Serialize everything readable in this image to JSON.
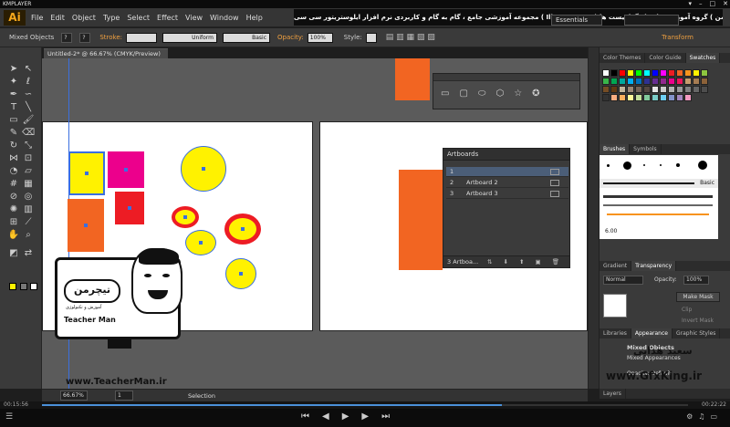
{
  "player": {
    "name": "KMPLAYER",
    "time_elapsed": "00:15:56",
    "time_total": "00:22:22"
  },
  "menu": {
    "items": [
      "File",
      "Edit",
      "Object",
      "Type",
      "Select",
      "Effect",
      "View",
      "Window",
      "Help"
    ],
    "course_title": "مجموعه آموزشی جامع ، گام به گام و کاربردی نرم افزار ایلوستریتور سی سی ( Illustrator cc )  مدرس : سعید هدایی ( تیچرمن ) گروه آموزشی پادشاه گرافیست ها",
    "workspace": "Essentials"
  },
  "control": {
    "selection_type": "Mixed Objects",
    "stroke_label": "Stroke:",
    "profile": "Uniform",
    "brush": "Basic",
    "opacity_label": "Opacity:",
    "opacity_value": "100%",
    "style_label": "Style:",
    "transform_label": "Transform"
  },
  "document": {
    "tab_title": "Untitled-2* @ 66.67% (CMYK/Preview)",
    "zoom": "66.67%",
    "page": "1",
    "status": "Selection"
  },
  "artboards_panel": {
    "title": "Artboards",
    "rows": [
      {
        "num": "1",
        "name": ""
      },
      {
        "num": "2",
        "name": "Artboard 2"
      },
      {
        "num": "3",
        "name": "Artboard 3"
      }
    ],
    "footer": "3 Artboa..."
  },
  "right_panels": {
    "tabs_top": [
      "Color Themes",
      "Color Guide",
      "Swatches"
    ],
    "tabs_brushes": [
      "Brushes",
      "Symbols"
    ],
    "brush_basic": "Basic",
    "brush_size": "6.00",
    "tabs_transparency": [
      "Gradient",
      "Transparency"
    ],
    "blend_mode": "Normal",
    "opacity_label": "Opacity:",
    "opacity_value": "100%",
    "make_mask": "Make Mask",
    "clip": "Clip",
    "invert_mask": "Invert Mask",
    "tabs_appearance": [
      "Libraries",
      "Appearance",
      "Graphic Styles"
    ],
    "appearance_title": "Mixed Objects",
    "appearance_sub": "Mixed Appearances",
    "appearance_opacity": "Opacity: Default",
    "layers_tab": "Layers"
  },
  "watermark": {
    "logo_fa": "تیچرمن",
    "logo_sub": "آموزش و تکنولوژی",
    "teacher_name": "Teacher Man",
    "site_left": "www.TeacherMan.ir",
    "site_right": "www.GfxKing.ir",
    "author_fa": "سعید هدایی"
  },
  "colors": {
    "orange": "#f26522",
    "yellow": "#fff200",
    "magenta": "#ec008c",
    "red": "#ed1c24",
    "selection": "#3a6fe0"
  }
}
